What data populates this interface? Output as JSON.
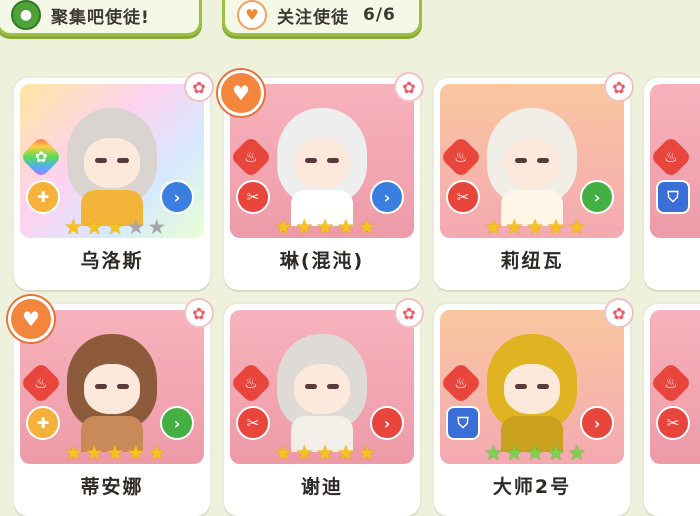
{
  "header": {
    "gather_label": "聚集吧使徒!",
    "follow_label": "关注使徒",
    "follow_count": "6/6"
  },
  "cards": [
    {
      "name": "乌洛斯",
      "stars_gold": 3,
      "stars_grey": 2,
      "star_color": "gold",
      "element": "gear",
      "role": "plus",
      "nav": "blue",
      "favorite": false,
      "art": "rainbow",
      "hair": "#d9d4cf",
      "outfit": "#f2b53a"
    },
    {
      "name": "琳(混沌)",
      "stars_gold": 5,
      "stars_grey": 0,
      "star_color": "gold",
      "element": "fire",
      "role": "blade",
      "nav": "blue",
      "favorite": true,
      "art": "pink",
      "hair": "#efeeee",
      "outfit": "#ffffff"
    },
    {
      "name": "莉纽瓦",
      "stars_gold": 5,
      "stars_grey": 0,
      "star_color": "gold",
      "element": "fire",
      "role": "blade",
      "nav": "green",
      "favorite": false,
      "art": "gold",
      "hair": "#f1eee8",
      "outfit": "#fff6e8"
    },
    {
      "name": "蒂安娜",
      "stars_gold": 5,
      "stars_grey": 0,
      "star_color": "gold",
      "element": "fire",
      "role": "plus",
      "nav": "green",
      "favorite": true,
      "art": "pink",
      "hair": "#8d5a3c",
      "outfit": "#c98a5a"
    },
    {
      "name": "谢迪",
      "stars_gold": 5,
      "stars_grey": 0,
      "star_color": "gold",
      "element": "fire",
      "role": "blade",
      "nav": "red",
      "favorite": false,
      "art": "pink",
      "hair": "#dedad6",
      "outfit": "#f4eee8"
    },
    {
      "name": "大师2号",
      "stars_gold": 5,
      "stars_grey": 0,
      "star_color": "green",
      "element": "fire",
      "role": "shield",
      "nav": "red",
      "favorite": false,
      "art": "gold",
      "hair": "#e0b322",
      "outfit": "#caa21e"
    }
  ],
  "icons": {
    "whistle": "whistle-icon",
    "heart": "heart-icon",
    "flower": "flower-icon"
  }
}
